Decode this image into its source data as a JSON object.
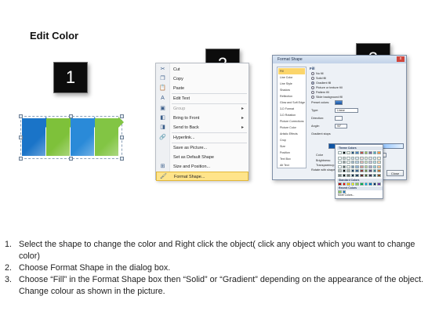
{
  "title": "Edit Color",
  "badges": [
    "1",
    "2",
    "3"
  ],
  "blocks_colors": [
    "#1a74c8",
    "#7ec13a",
    "#2a8ad8",
    "#82c544"
  ],
  "context_menu": {
    "items": [
      {
        "icon": "scissors-icon",
        "glyph": "✂",
        "label": "Cut",
        "enabled": true,
        "submenu": false
      },
      {
        "icon": "copy-icon",
        "glyph": "❐",
        "label": "Copy",
        "enabled": true,
        "submenu": false
      },
      {
        "icon": "paste-icon",
        "glyph": "📋",
        "label": "Paste",
        "enabled": true,
        "submenu": false
      },
      {
        "icon": "edit-text-icon",
        "glyph": "A",
        "label": "Edit Text",
        "enabled": true,
        "submenu": false
      },
      {
        "icon": "group-icon",
        "glyph": "▣",
        "label": "Group",
        "enabled": false,
        "submenu": true
      },
      {
        "icon": "bring-to-front-icon",
        "glyph": "◧",
        "label": "Bring to Front",
        "enabled": true,
        "submenu": true
      },
      {
        "icon": "send-to-back-icon",
        "glyph": "◨",
        "label": "Send to Back",
        "enabled": true,
        "submenu": true
      },
      {
        "icon": "hyperlink-icon",
        "glyph": "🔗",
        "label": "Hyperlink...",
        "enabled": true,
        "submenu": false
      },
      {
        "icon": "save-picture-icon",
        "glyph": "",
        "label": "Save as Picture...",
        "enabled": true,
        "submenu": false
      },
      {
        "icon": "default-shape-icon",
        "glyph": "",
        "label": "Set as Default Shape",
        "enabled": true,
        "submenu": false
      },
      {
        "icon": "size-position-icon",
        "glyph": "⊞",
        "label": "Size and Position...",
        "enabled": true,
        "submenu": false
      },
      {
        "icon": "format-shape-icon",
        "glyph": "🖌",
        "label": "Format Shape...",
        "enabled": true,
        "submenu": false,
        "highlighted": true
      }
    ]
  },
  "dialog": {
    "title": "Format Shape",
    "close": "x",
    "nav": [
      "Fill",
      "Line Color",
      "Line Style",
      "Shadow",
      "Reflection",
      "Glow and Soft Edges",
      "3-D Format",
      "3-D Rotation",
      "Picture Corrections",
      "Picture Color",
      "Artistic Effects",
      "Crop",
      "Size",
      "Position",
      "Text Box",
      "Alt Text"
    ],
    "nav_selected": 0,
    "fill_heading": "Fill",
    "fill_options": [
      {
        "label": "No fill",
        "on": false
      },
      {
        "label": "Solid fill",
        "on": false
      },
      {
        "label": "Gradient fill",
        "on": true
      },
      {
        "label": "Picture or texture fill",
        "on": false
      },
      {
        "label": "Pattern fill",
        "on": false
      },
      {
        "label": "Slide background fill",
        "on": false
      }
    ],
    "fields": {
      "preset_colors": "Preset colors:",
      "type": "Type:",
      "type_value": "Linear",
      "direction": "Direction:",
      "angle": "Angle:",
      "angle_value": "90°",
      "gradient_stops": "Gradient stops",
      "color": "Color",
      "position": "Position:",
      "position_value": "0%",
      "brightness": "Brightness:",
      "transparency": "Transparency:",
      "rotate": "Rotate with shape"
    },
    "close_button": "Close"
  },
  "palette": {
    "theme_colors": "Theme Colors",
    "standard_colors": "Standard Colors",
    "recent_colors": "Recent Colors",
    "more_colors": "More Colors...",
    "top_row": [
      "#ffffff",
      "#000000",
      "#eeece1",
      "#1f497d",
      "#4f81bd",
      "#c0504d",
      "#9bbb59",
      "#8064a2",
      "#4bacc6",
      "#f79646"
    ],
    "standard": [
      "#c00000",
      "#ff0000",
      "#ffc000",
      "#ffff00",
      "#92d050",
      "#00b050",
      "#00b0f0",
      "#0070c0",
      "#002060",
      "#7030a0"
    ],
    "recent": [
      "#92d050",
      "#1a74c8"
    ]
  },
  "steps": [
    {
      "num": "1.",
      "text": "Select the shape to change the color and Right click the object( click any object which you want to change color)"
    },
    {
      "num": "2.",
      "text": "Choose Format Shape in the dialog box."
    },
    {
      "num": "3.",
      "text": "Choose “Fill” in the Format Shape box then “Solid” or “Gradient” depending on the appearance of the object. Change colour as shown in the picture."
    }
  ]
}
